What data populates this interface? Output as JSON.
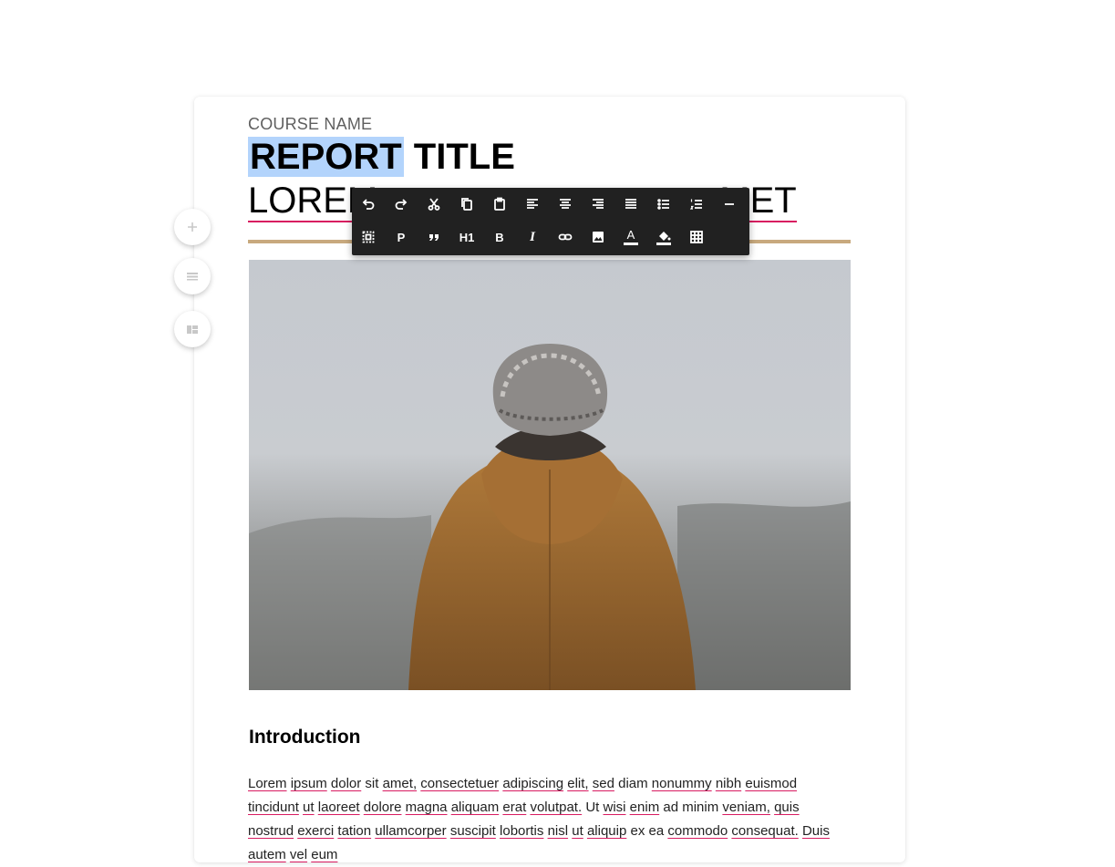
{
  "document": {
    "course_name": "COURSE NAME",
    "title_selected": "REPORT",
    "title_rest": " TITLE",
    "subtitle_start": "LOREM",
    "subtitle_end": "MET",
    "intro_heading": "Introduction",
    "body_words": [
      {
        "t": "Lorem",
        "s": true
      },
      {
        "t": "ipsum",
        "s": true
      },
      {
        "t": "dolor",
        "s": true
      },
      {
        "t": "sit",
        "s": false
      },
      {
        "t": "amet,",
        "s": true
      },
      {
        "t": "consectetuer",
        "s": true
      },
      {
        "t": "adipiscing",
        "s": true
      },
      {
        "t": "elit,",
        "s": true
      },
      {
        "t": "sed",
        "s": true
      },
      {
        "t": "diam",
        "s": false
      },
      {
        "t": "nonummy",
        "s": true
      },
      {
        "t": "nibh",
        "s": true
      },
      {
        "t": "euismod",
        "s": true
      },
      {
        "t": "tincidunt",
        "s": true
      },
      {
        "t": "ut",
        "s": true
      },
      {
        "t": "laoreet",
        "s": true
      },
      {
        "t": "dolore",
        "s": true
      },
      {
        "t": "magna",
        "s": true
      },
      {
        "t": "aliquam",
        "s": true
      },
      {
        "t": "erat",
        "s": true
      },
      {
        "t": "volutpat.",
        "s": true
      },
      {
        "t": "Ut",
        "s": false
      },
      {
        "t": "wisi",
        "s": true
      },
      {
        "t": "enim",
        "s": true
      },
      {
        "t": "ad",
        "s": false
      },
      {
        "t": "minim",
        "s": false
      },
      {
        "t": "veniam,",
        "s": true
      },
      {
        "t": "quis",
        "s": true
      },
      {
        "t": "nostrud",
        "s": true
      },
      {
        "t": "exerci",
        "s": true
      },
      {
        "t": "tation",
        "s": true
      },
      {
        "t": "ullamcorper",
        "s": true
      },
      {
        "t": "suscipit",
        "s": true
      },
      {
        "t": "lobortis",
        "s": true
      },
      {
        "t": "nisl",
        "s": true
      },
      {
        "t": "ut",
        "s": true
      },
      {
        "t": "aliquip",
        "s": true
      },
      {
        "t": "ex",
        "s": false
      },
      {
        "t": "ea",
        "s": false
      },
      {
        "t": "commodo",
        "s": true
      },
      {
        "t": "consequat.",
        "s": true
      },
      {
        "t": "Duis",
        "s": true
      },
      {
        "t": "autem",
        "s": true
      },
      {
        "t": "vel",
        "s": true
      },
      {
        "t": "eum",
        "s": true
      }
    ]
  },
  "toolbar": {
    "row1": [
      "undo-icon",
      "redo-icon",
      "cut-icon",
      "copy-icon",
      "paste-icon",
      "align-left-icon",
      "align-center-icon",
      "align-right-icon",
      "align-justify-icon",
      "bullet-list-icon",
      "numbered-list-icon",
      "horizontal-rule-icon"
    ],
    "row2": [
      "select-all-icon",
      "paragraph-icon",
      "blockquote-icon",
      "heading-1-icon",
      "bold-icon",
      "italic-icon",
      "link-icon",
      "image-icon",
      "text-color-icon",
      "fill-color-icon",
      "table-icon"
    ],
    "paragraph_label": "P",
    "heading_label": "H1",
    "bold_label": "B",
    "italic_label": "I",
    "text_color_label": "A"
  },
  "side_actions": [
    "add-icon",
    "section-icon",
    "layout-icon"
  ],
  "colors": {
    "accent_rule": "#c8a97e",
    "spellcheck_underline": "#d81b60",
    "selection": "#b3d4fc",
    "toolbar_bg": "#212121"
  }
}
